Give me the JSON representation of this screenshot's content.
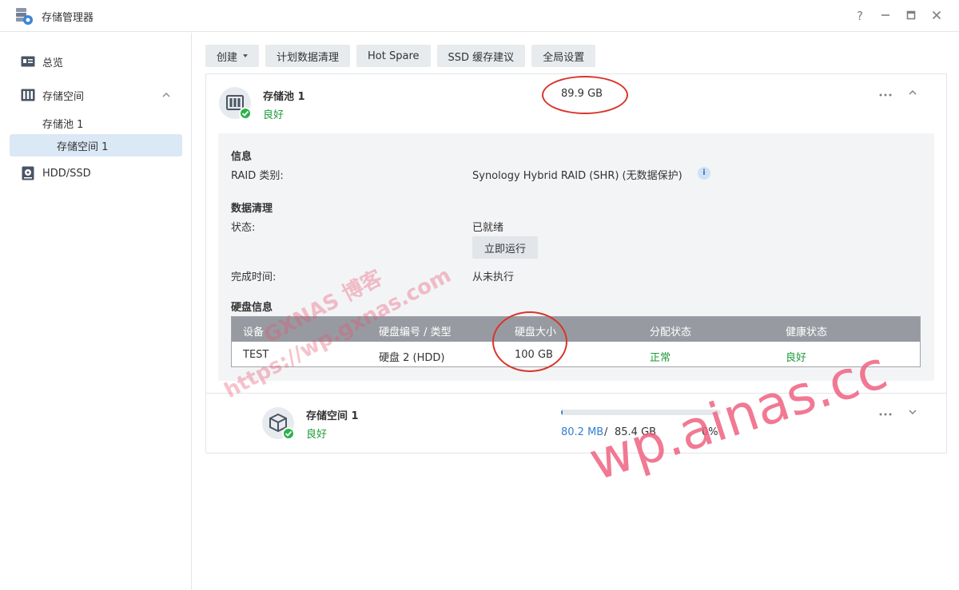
{
  "window": {
    "title": "存储管理器",
    "controls": [
      "?",
      "—",
      "□",
      "✕"
    ]
  },
  "sidebar": {
    "items": [
      {
        "label": "总览",
        "icon": "overview-icon"
      },
      {
        "label": "存储空间",
        "icon": "storage-icon"
      },
      {
        "label": "HDD/SSD",
        "icon": "disk-icon"
      }
    ],
    "sub_items": [
      {
        "label": "存储池 1"
      },
      {
        "label": "存储空间 1",
        "selected": true
      }
    ]
  },
  "toolbar": {
    "create_label": "创建",
    "schedule_label": "计划数据清理",
    "hotspare_label": "Hot Spare",
    "ssd_label": "SSD 缓存建议",
    "global_label": "全局设置"
  },
  "pool": {
    "name": "存储池 1",
    "status": "良好",
    "size": "89.9 GB",
    "info_title": "信息",
    "raid_label": "RAID 类别:",
    "raid_value": "Synology Hybrid RAID (SHR) (无数据保护)",
    "scrub_title": "数据清理",
    "state_label": "状态:",
    "state_value": "已就绪",
    "run_now_label": "立即运行",
    "finish_label": "完成时间:",
    "finish_value": "从未执行",
    "disk_title": "硬盘信息",
    "disk_table": {
      "headers": [
        "设备",
        "硬盘编号 / 类型",
        "硬盘大小",
        "分配状态",
        "健康状态"
      ],
      "rows": [
        [
          "TEST",
          "硬盘 2 (HDD)",
          "100 GB",
          "正常",
          "良好"
        ]
      ]
    }
  },
  "volume": {
    "name": "存储空间 1",
    "status": "良好",
    "used": "80.2 MB",
    "separator": "/",
    "total": "85.4 GB",
    "percent": "0%",
    "usage_fraction": 0.01
  },
  "watermarks": {
    "line1": "GXNAS 博客",
    "line2": "https://wp.gxnas.com",
    "big": "wp.ainas.cc"
  },
  "colors": {
    "accent": "#2f7fd1",
    "ok_green": "#1f9a3a",
    "annotation_red": "#d9342b",
    "watermark_pink": "#ef6280"
  }
}
